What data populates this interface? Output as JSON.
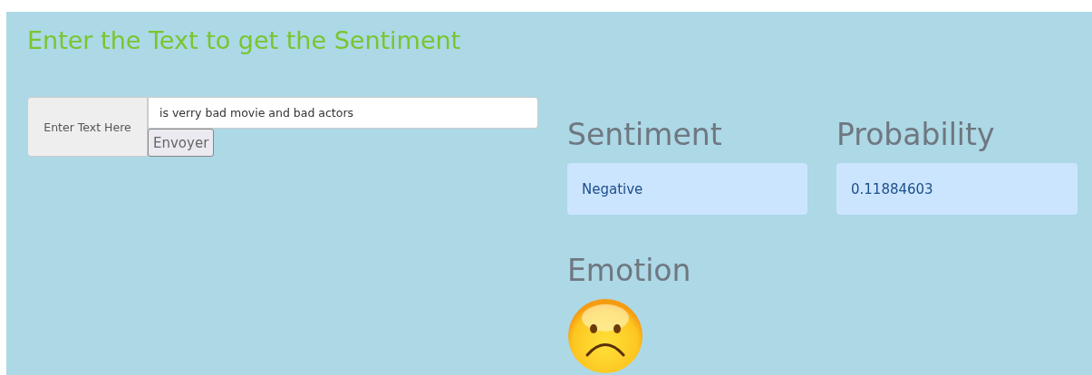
{
  "title": "Enter the Text to get the Sentiment",
  "form": {
    "label": "Enter Text Here",
    "value": "is verry bad movie and bad actors",
    "button": "Envoyer"
  },
  "results": [
    {
      "heading": "Sentiment",
      "value": "Negative"
    },
    {
      "heading": "Probability",
      "value": "0.11884603"
    }
  ],
  "emotion": {
    "heading": "Emotion",
    "kind": "sad"
  }
}
